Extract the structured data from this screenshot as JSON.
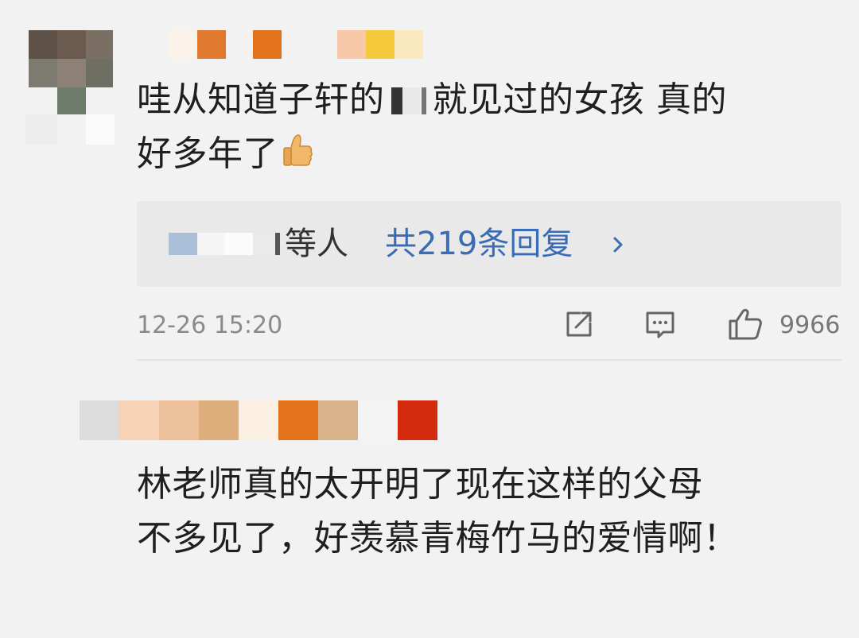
{
  "comments": [
    {
      "text_line1_before_mask": "哇从知道子轩的",
      "text_line1_after_mask": "就见过的女孩 真的",
      "text_line2": "好多年了",
      "emoji": "thumbs-up-icon",
      "replies": {
        "names_suffix": "等人",
        "count_label": "共219条回复",
        "chevron": "chevron-right-icon"
      },
      "timestamp": "12-26 15:20",
      "actions": {
        "share_icon": "share-icon",
        "comment_icon": "comment-icon",
        "like_icon": "like-icon",
        "like_count": "9966"
      }
    },
    {
      "text_line1": "林老师真的太开明了现在这样的父母",
      "text_line2": "不多见了，好羡慕青梅竹马的爱情啊！"
    }
  ],
  "colors": {
    "background": "#f2f2f2",
    "reply_box": "#e9e9e9",
    "link_blue": "#3a6bb5",
    "meta_gray": "#8a8a8a"
  }
}
